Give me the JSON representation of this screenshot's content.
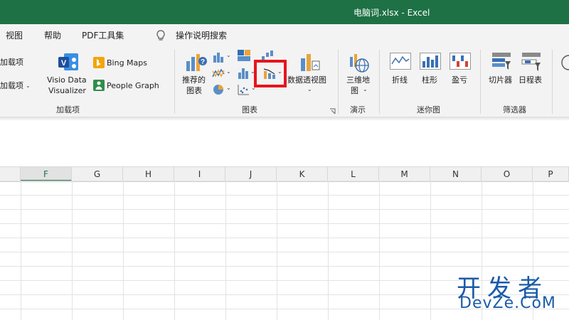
{
  "title": "电脑词.xlsx - Excel",
  "menu": {
    "view": "视图",
    "help": "帮助",
    "pdf_tools": "PDF工具集",
    "tell_me": "操作说明搜索"
  },
  "ribbon": {
    "addins": {
      "get_addins": "加载项",
      "my_addins": "加载项",
      "visio_line1": "Visio Data",
      "visio_line2": "Visualizer",
      "bing_maps": "Bing Maps",
      "people_graph": "People Graph",
      "group_label": "加载项"
    },
    "charts": {
      "recommended_line1": "推荐的",
      "recommended_line2": "图表",
      "pivot_chart": "数据透视图",
      "group_label": "图表"
    },
    "tours": {
      "map_line1": "三维地",
      "map_line2": "图",
      "group_label": "演示"
    },
    "sparklines": {
      "line": "折线",
      "column": "柱形",
      "win_loss": "盈亏",
      "group_label": "迷你图"
    },
    "filters": {
      "slicer": "切片器",
      "timeline": "日程表",
      "group_label": "筛选器"
    }
  },
  "columns": [
    "F",
    "G",
    "H",
    "I",
    "J",
    "K",
    "L",
    "M",
    "N",
    "O",
    "P"
  ],
  "watermark": {
    "cn": "开发者",
    "en": "DevZe.CoM"
  },
  "colors": {
    "accent": "#1e7145",
    "highlight": "#e8141b",
    "watermark": "#1a5ba8"
  }
}
